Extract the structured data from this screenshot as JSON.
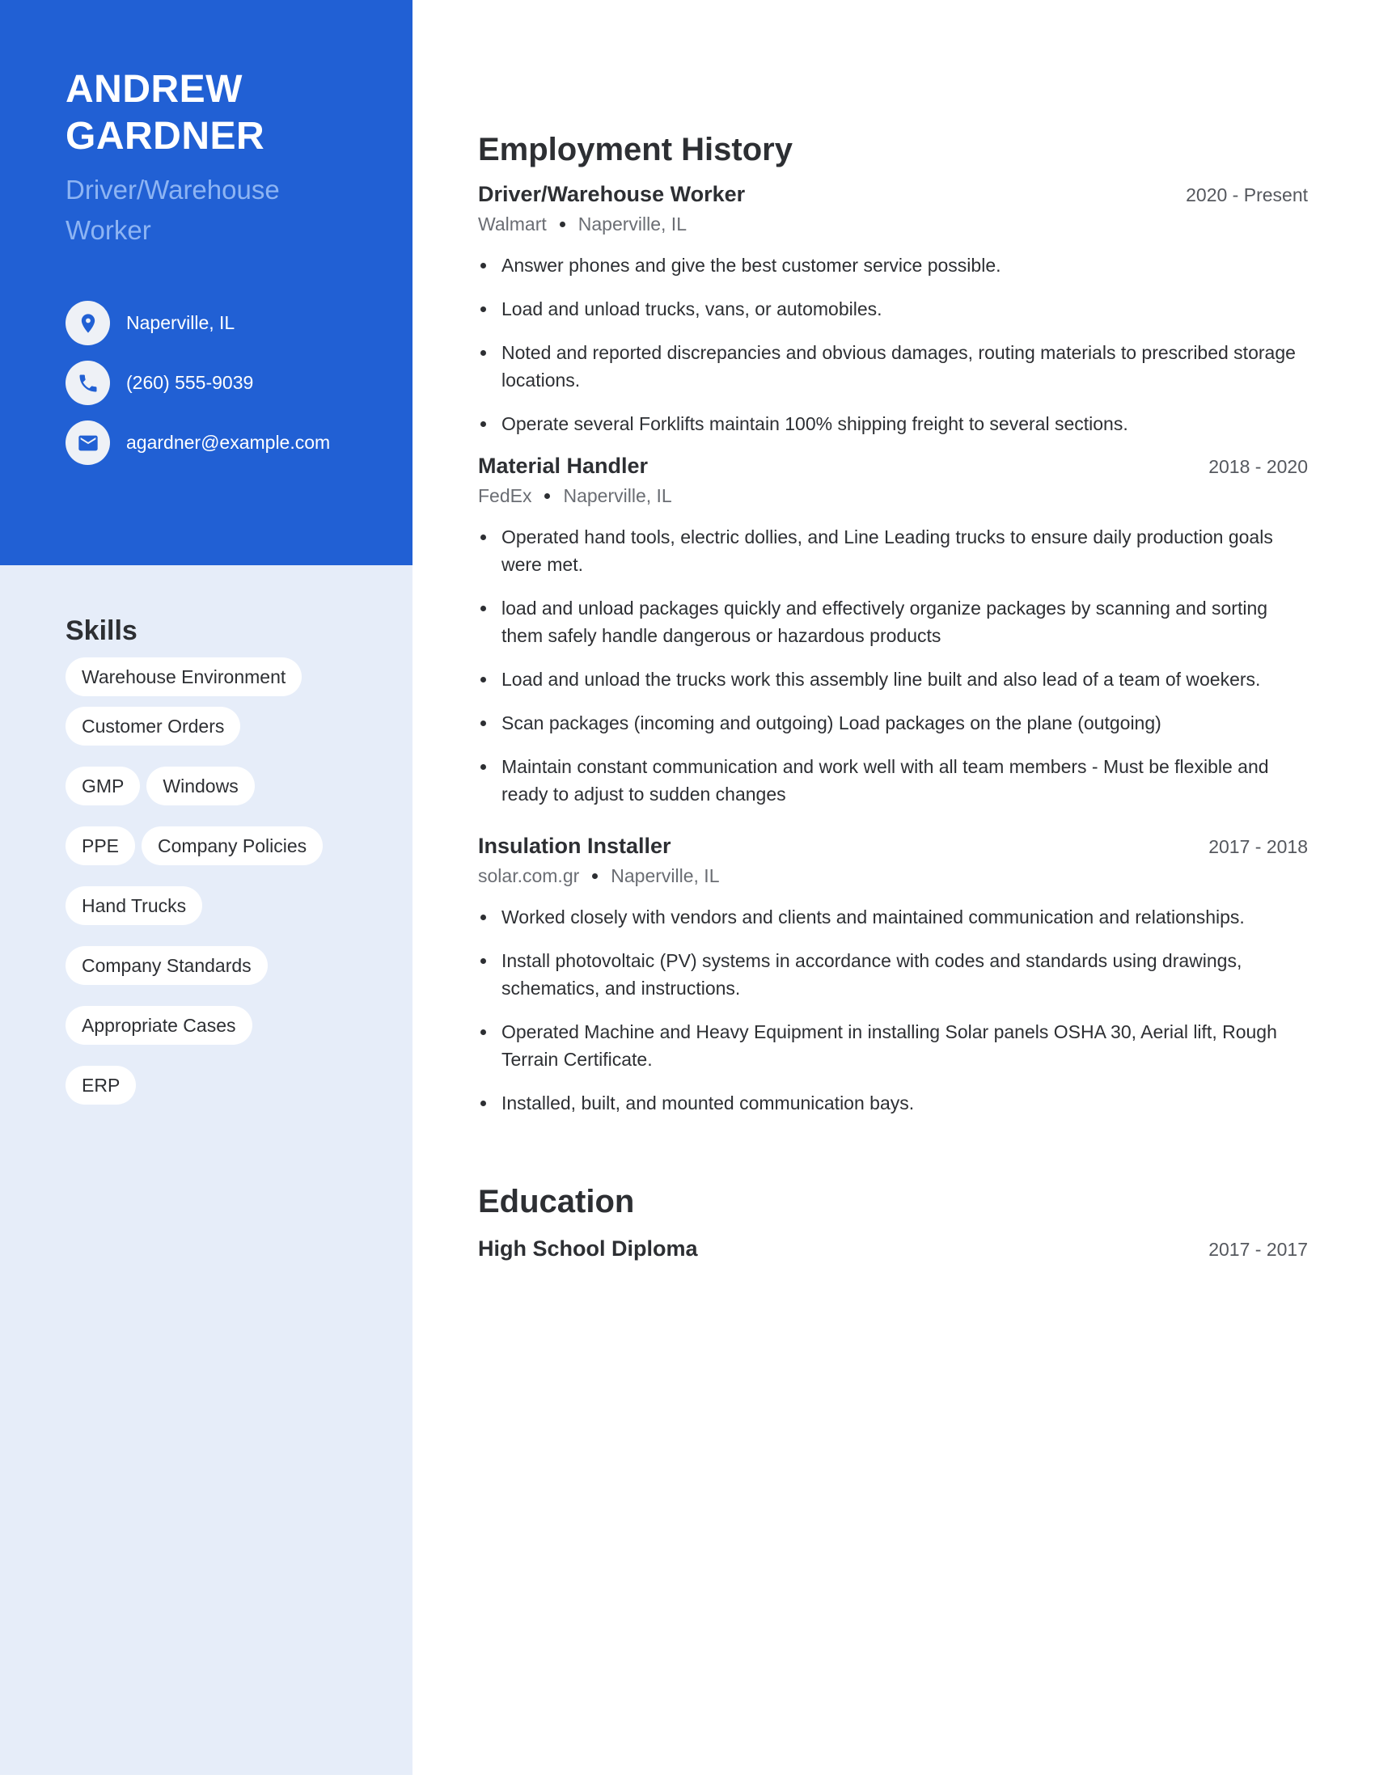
{
  "profile": {
    "name_line1": "ANDREW",
    "name_line2": "GARDNER",
    "title": "Driver/Warehouse Worker"
  },
  "contacts": [
    {
      "icon": "location-pin-icon",
      "text": "Naperville, IL"
    },
    {
      "icon": "phone-icon",
      "text": "(260) 555-9039"
    },
    {
      "icon": "mail-icon",
      "text": "agardner@example.com"
    }
  ],
  "skills": {
    "title": "Skills",
    "items": [
      "Warehouse Environment",
      "Customer Orders",
      "GMP",
      "Windows",
      "PPE",
      "Company Policies",
      "Hand Trucks",
      "Company Standards",
      "Appropriate Cases",
      "ERP"
    ]
  },
  "employment": {
    "title": "Employment History",
    "jobs": [
      {
        "title": "Driver/Warehouse Worker",
        "dates": "2020 - Present",
        "company": "Walmart",
        "location": "Naperville, IL",
        "bullets": [
          "Answer phones and give the best customer service possible.",
          "Load and unload trucks, vans, or automobiles.",
          "Noted and reported discrepancies and obvious damages, routing materials to prescribed storage locations.",
          "Operate several Forklifts maintain 100% shipping freight to several sections."
        ]
      },
      {
        "title": "Material Handler",
        "dates": "2018 - 2020",
        "company": "FedEx",
        "location": "Naperville, IL",
        "bullets": [
          "Operated hand tools, electric dollies, and Line Leading trucks to ensure daily production goals were met.",
          "load and unload packages quickly and effectively organize packages by scanning and sorting them safely handle dangerous or hazardous products",
          "Load and unload the trucks work this assembly line built and also lead of a team of woekers.",
          "Scan packages (incoming and outgoing) Load packages on the plane (outgoing)",
          "Maintain constant communication and work well with all team members - Must be flexible and ready to adjust to sudden changes"
        ]
      },
      {
        "title": "Insulation Installer",
        "dates": "2017 - 2018",
        "company": "solar.com.gr",
        "location": "Naperville, IL",
        "bullets": [
          "Worked closely with vendors and clients and maintained communication and relationships.",
          "Install photovoltaic (PV) systems in accordance with codes and standards using drawings, schematics, and instructions.",
          "Operated Machine and Heavy Equipment in installing Solar panels OSHA 30, Aerial lift, Rough Terrain Certificate.",
          "Installed, built, and mounted communication bays."
        ]
      }
    ]
  },
  "education": {
    "title": "Education",
    "items": [
      {
        "degree": "High School Diploma",
        "dates": "2017 - 2017"
      }
    ]
  },
  "colors": {
    "accent": "#2160d4",
    "sidebar_bg": "#e6edf9",
    "title_light": "#8db4f3",
    "text": "#2d2f33"
  }
}
